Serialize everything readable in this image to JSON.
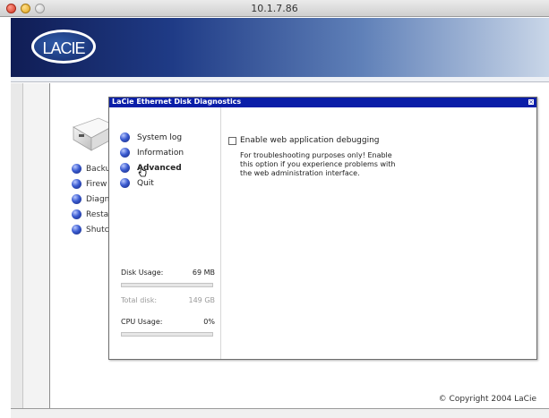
{
  "window": {
    "title": "10.1.7.86"
  },
  "brand": {
    "logo_text": "LACIE"
  },
  "background_nav": {
    "items": [
      {
        "label": "Backu"
      },
      {
        "label": "Firew"
      },
      {
        "label": "Diagn"
      },
      {
        "label": "Resta"
      },
      {
        "label": "Shutc"
      }
    ]
  },
  "dialog": {
    "title": "LaCie Ethernet Disk Diagnostics",
    "close_glyph": "×",
    "menu": [
      {
        "label": "System log",
        "active": false
      },
      {
        "label": "Information",
        "active": false
      },
      {
        "label": "Advanced",
        "active": true
      },
      {
        "label": "Quit",
        "active": false
      }
    ],
    "option": {
      "label": "Enable web application debugging",
      "checked": false,
      "description": "For troubleshooting purposes only! Enable this option if you experience problems with the web administration interface."
    },
    "stats": {
      "disk_usage_label": "Disk Usage:",
      "disk_usage_value": "69 MB",
      "disk_usage_fraction": 0.0,
      "total_disk_label": "Total disk:",
      "total_disk_value": "149 GB",
      "cpu_usage_label": "CPU Usage:",
      "cpu_usage_value": "0%",
      "cpu_usage_fraction": 0.0
    }
  },
  "footer": {
    "copyright": "© Copyright 2004 LaCie"
  },
  "colors": {
    "dialog_titlebar": "#0a1ea8",
    "header_dark": "#101d55",
    "header_light": "#c9d6e8",
    "ball_blue": "#3a5bd0"
  },
  "icons": {
    "traffic_lights": [
      "close-icon",
      "minimize-icon",
      "maximize-icon"
    ],
    "menu_bullet": "blue-ball-icon",
    "cursor": "hand-pointer-icon"
  }
}
